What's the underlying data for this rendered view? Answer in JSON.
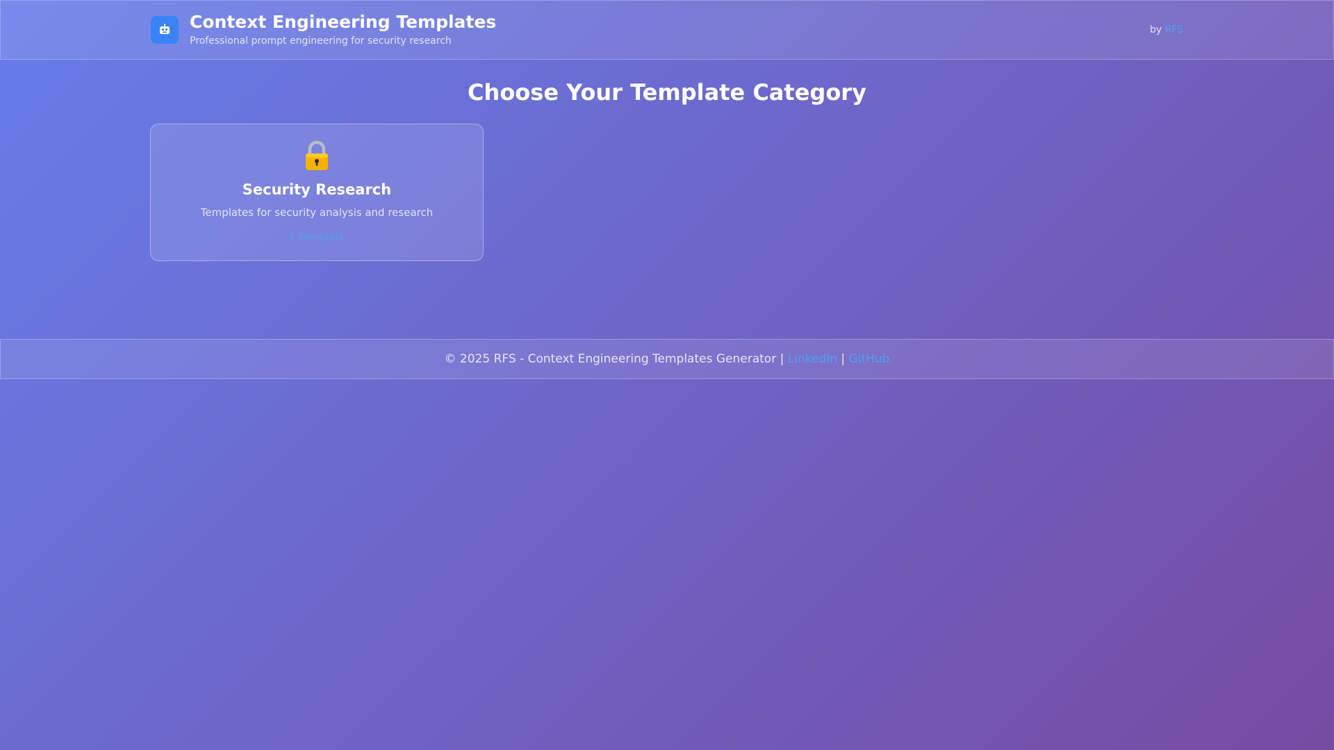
{
  "header": {
    "title": "Context Engineering Templates",
    "subtitle": "Professional prompt engineering for security research",
    "byline_prefix": "by",
    "byline_link": "RFS",
    "logo_icon": "robot-icon",
    "logo_color": "#3b82f6"
  },
  "main": {
    "heading": "Choose Your Template Category",
    "categories": [
      {
        "icon": "lock-icon",
        "title": "Security Research",
        "description": "Templates for security analysis and research",
        "count_label": "1 template"
      }
    ]
  },
  "footer": {
    "copyright": "© 2025 RFS - Context Engineering Templates Generator",
    "separator": "|",
    "linkedin": "LinkedIn",
    "github": "GitHub"
  },
  "colors": {
    "gradient_start": "#667eea",
    "gradient_end": "#764ba2",
    "link": "#4fa0f5"
  }
}
